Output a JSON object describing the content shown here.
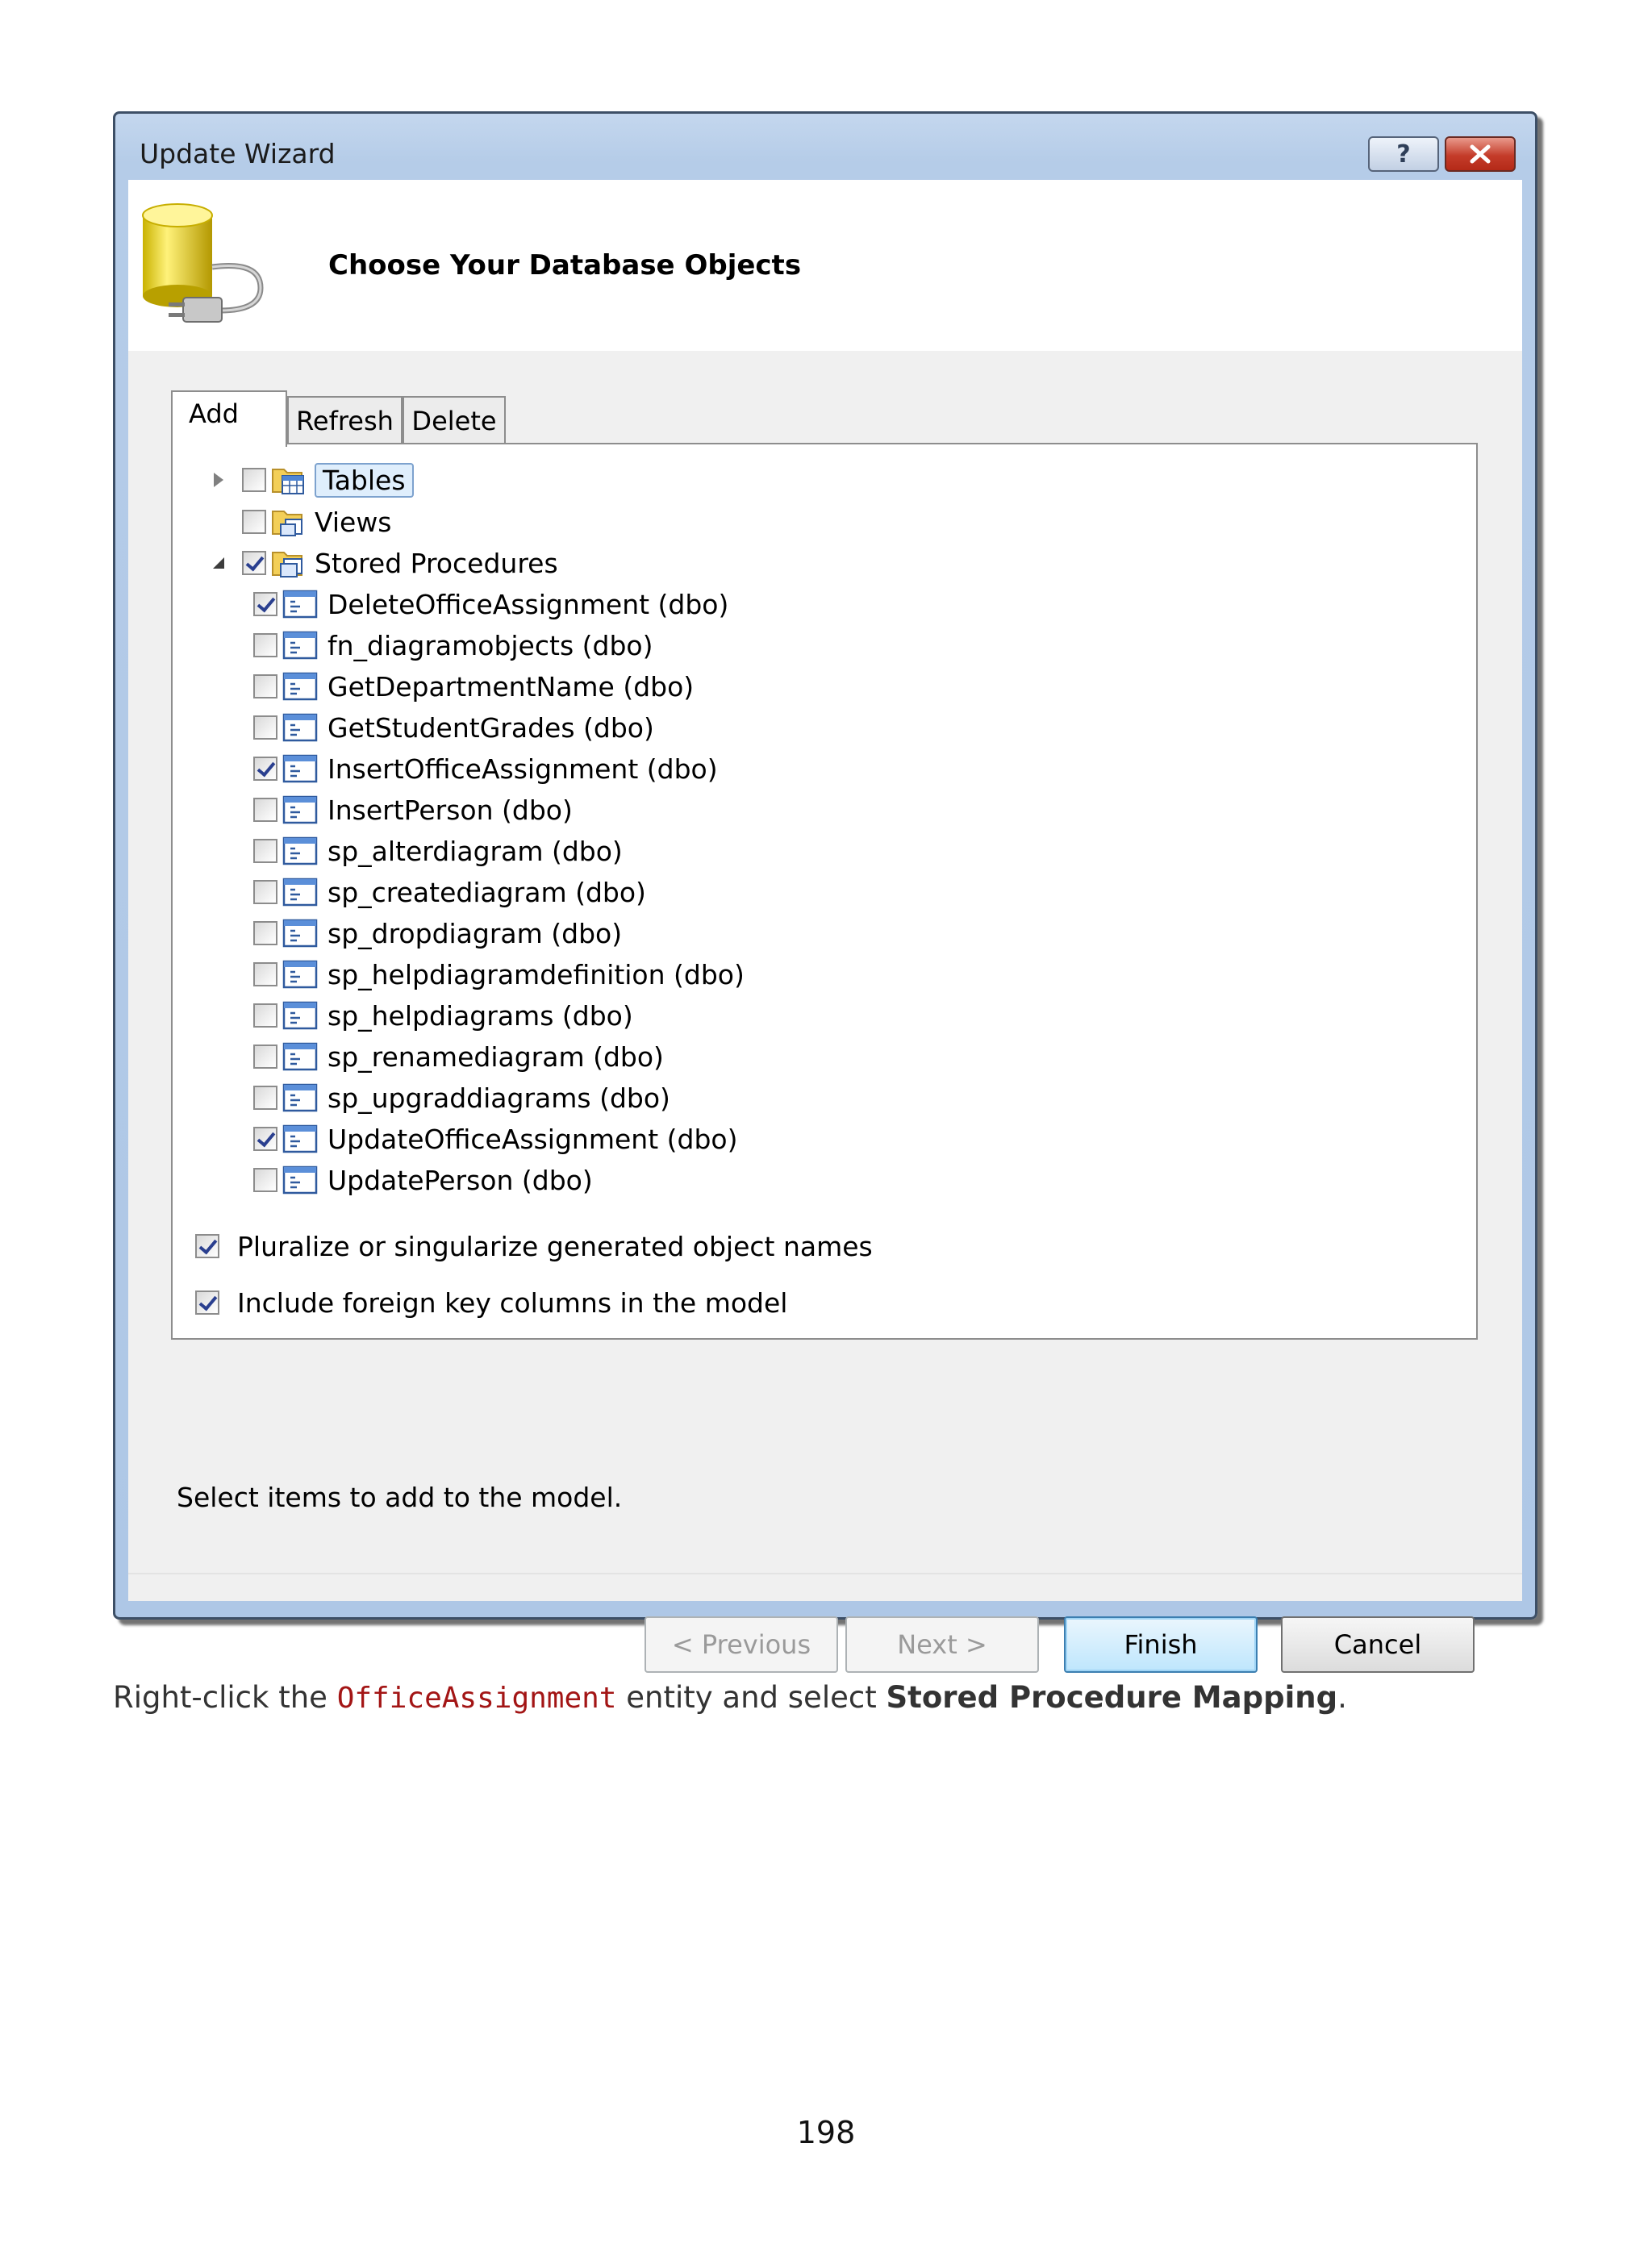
{
  "window": {
    "title": "Update Wizard",
    "help_label": "?",
    "header_title": "Choose Your Database Objects"
  },
  "tabs": [
    {
      "label": "Add",
      "selected": true
    },
    {
      "label": "Refresh",
      "selected": false
    },
    {
      "label": "Delete",
      "selected": false
    }
  ],
  "tree": {
    "tables": {
      "label": "Tables",
      "checked": false,
      "expanded": false,
      "selected": true
    },
    "views": {
      "label": "Views",
      "checked": false
    },
    "stored_procedures": {
      "label": "Stored Procedures",
      "checked": true,
      "expanded": true,
      "items": [
        {
          "label": "DeleteOfficeAssignment (dbo)",
          "checked": true
        },
        {
          "label": "fn_diagramobjects (dbo)",
          "checked": false
        },
        {
          "label": "GetDepartmentName (dbo)",
          "checked": false
        },
        {
          "label": "GetStudentGrades (dbo)",
          "checked": false
        },
        {
          "label": "InsertOfficeAssignment (dbo)",
          "checked": true
        },
        {
          "label": "InsertPerson (dbo)",
          "checked": false
        },
        {
          "label": "sp_alterdiagram (dbo)",
          "checked": false
        },
        {
          "label": "sp_creatediagram (dbo)",
          "checked": false
        },
        {
          "label": "sp_dropdiagram (dbo)",
          "checked": false
        },
        {
          "label": "sp_helpdiagramdefinition (dbo)",
          "checked": false
        },
        {
          "label": "sp_helpdiagrams (dbo)",
          "checked": false
        },
        {
          "label": "sp_renamediagram (dbo)",
          "checked": false
        },
        {
          "label": "sp_upgraddiagrams (dbo)",
          "checked": false
        },
        {
          "label": "UpdateOfficeAssignment (dbo)",
          "checked": true
        },
        {
          "label": "UpdatePerson (dbo)",
          "checked": false
        }
      ]
    }
  },
  "options": {
    "pluralize": {
      "label": "Pluralize or singularize generated object names",
      "checked": true
    },
    "foreign_keys": {
      "label": "Include foreign key columns in the model",
      "checked": true
    }
  },
  "hint": "Select items to add to the model.",
  "buttons": {
    "previous": "< Previous",
    "next": "Next >",
    "finish": "Finish",
    "cancel": "Cancel"
  },
  "caption": {
    "prefix": "Right-click the ",
    "code": "OfficeAssignment",
    "middle": " entity and select ",
    "bold": "Stored Procedure Mapping",
    "suffix": "."
  },
  "page_number": "198",
  "colors": {
    "title_bar": "#b5cce8",
    "close_button": "#c43c2a",
    "checkmark": "#2a3f8f",
    "code_text": "#a31515"
  }
}
